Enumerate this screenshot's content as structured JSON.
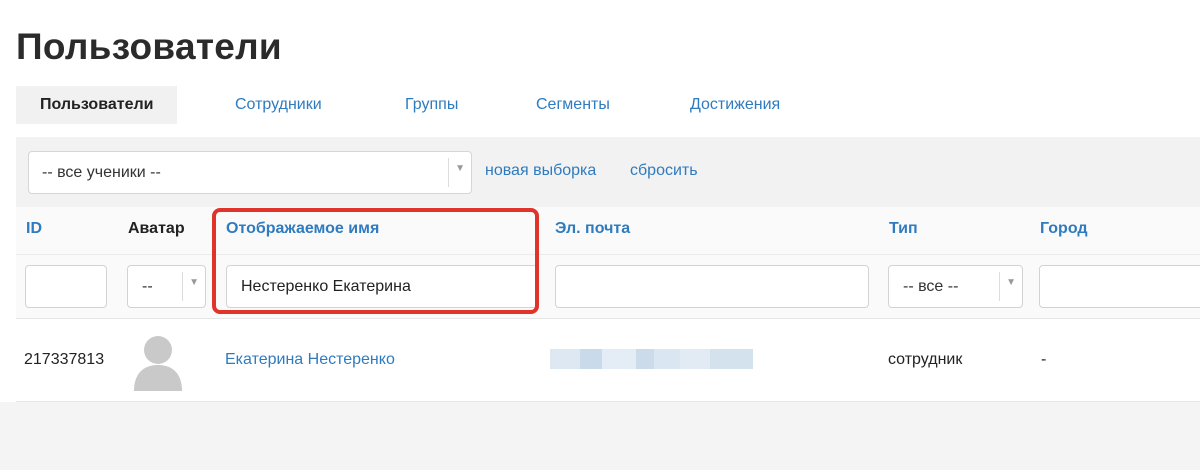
{
  "page": {
    "title": "Пользователи"
  },
  "tabs": [
    {
      "label": "Пользователи",
      "active": true
    },
    {
      "label": "Сотрудники"
    },
    {
      "label": "Группы"
    },
    {
      "label": "Сегменты"
    },
    {
      "label": "Достижения"
    }
  ],
  "filter": {
    "selection_value": "-- все ученики --",
    "new_selection_link": "новая выборка",
    "reset_link": "сбросить"
  },
  "table": {
    "columns": {
      "id": "ID",
      "avatar": "Аватар",
      "display_name": "Отображаемое имя",
      "email": "Эл. почта",
      "type": "Тип",
      "city": "Город"
    },
    "filters": {
      "id": "",
      "avatar_select": "--",
      "display_name": "Нестеренко Екатерина",
      "email": "",
      "type_select": "-- все --",
      "city": ""
    },
    "rows": [
      {
        "id": "217337813",
        "display_name": "Екатерина Нестеренко",
        "type": "сотрудник",
        "city": "-"
      }
    ]
  },
  "colors": {
    "link": "#2f7bbf",
    "highlight": "#e0342b",
    "avatar_placeholder": "#c9c9c9"
  },
  "icons": {
    "avatar": "user-silhouette-icon",
    "dropdown": "caret-down-icon"
  }
}
